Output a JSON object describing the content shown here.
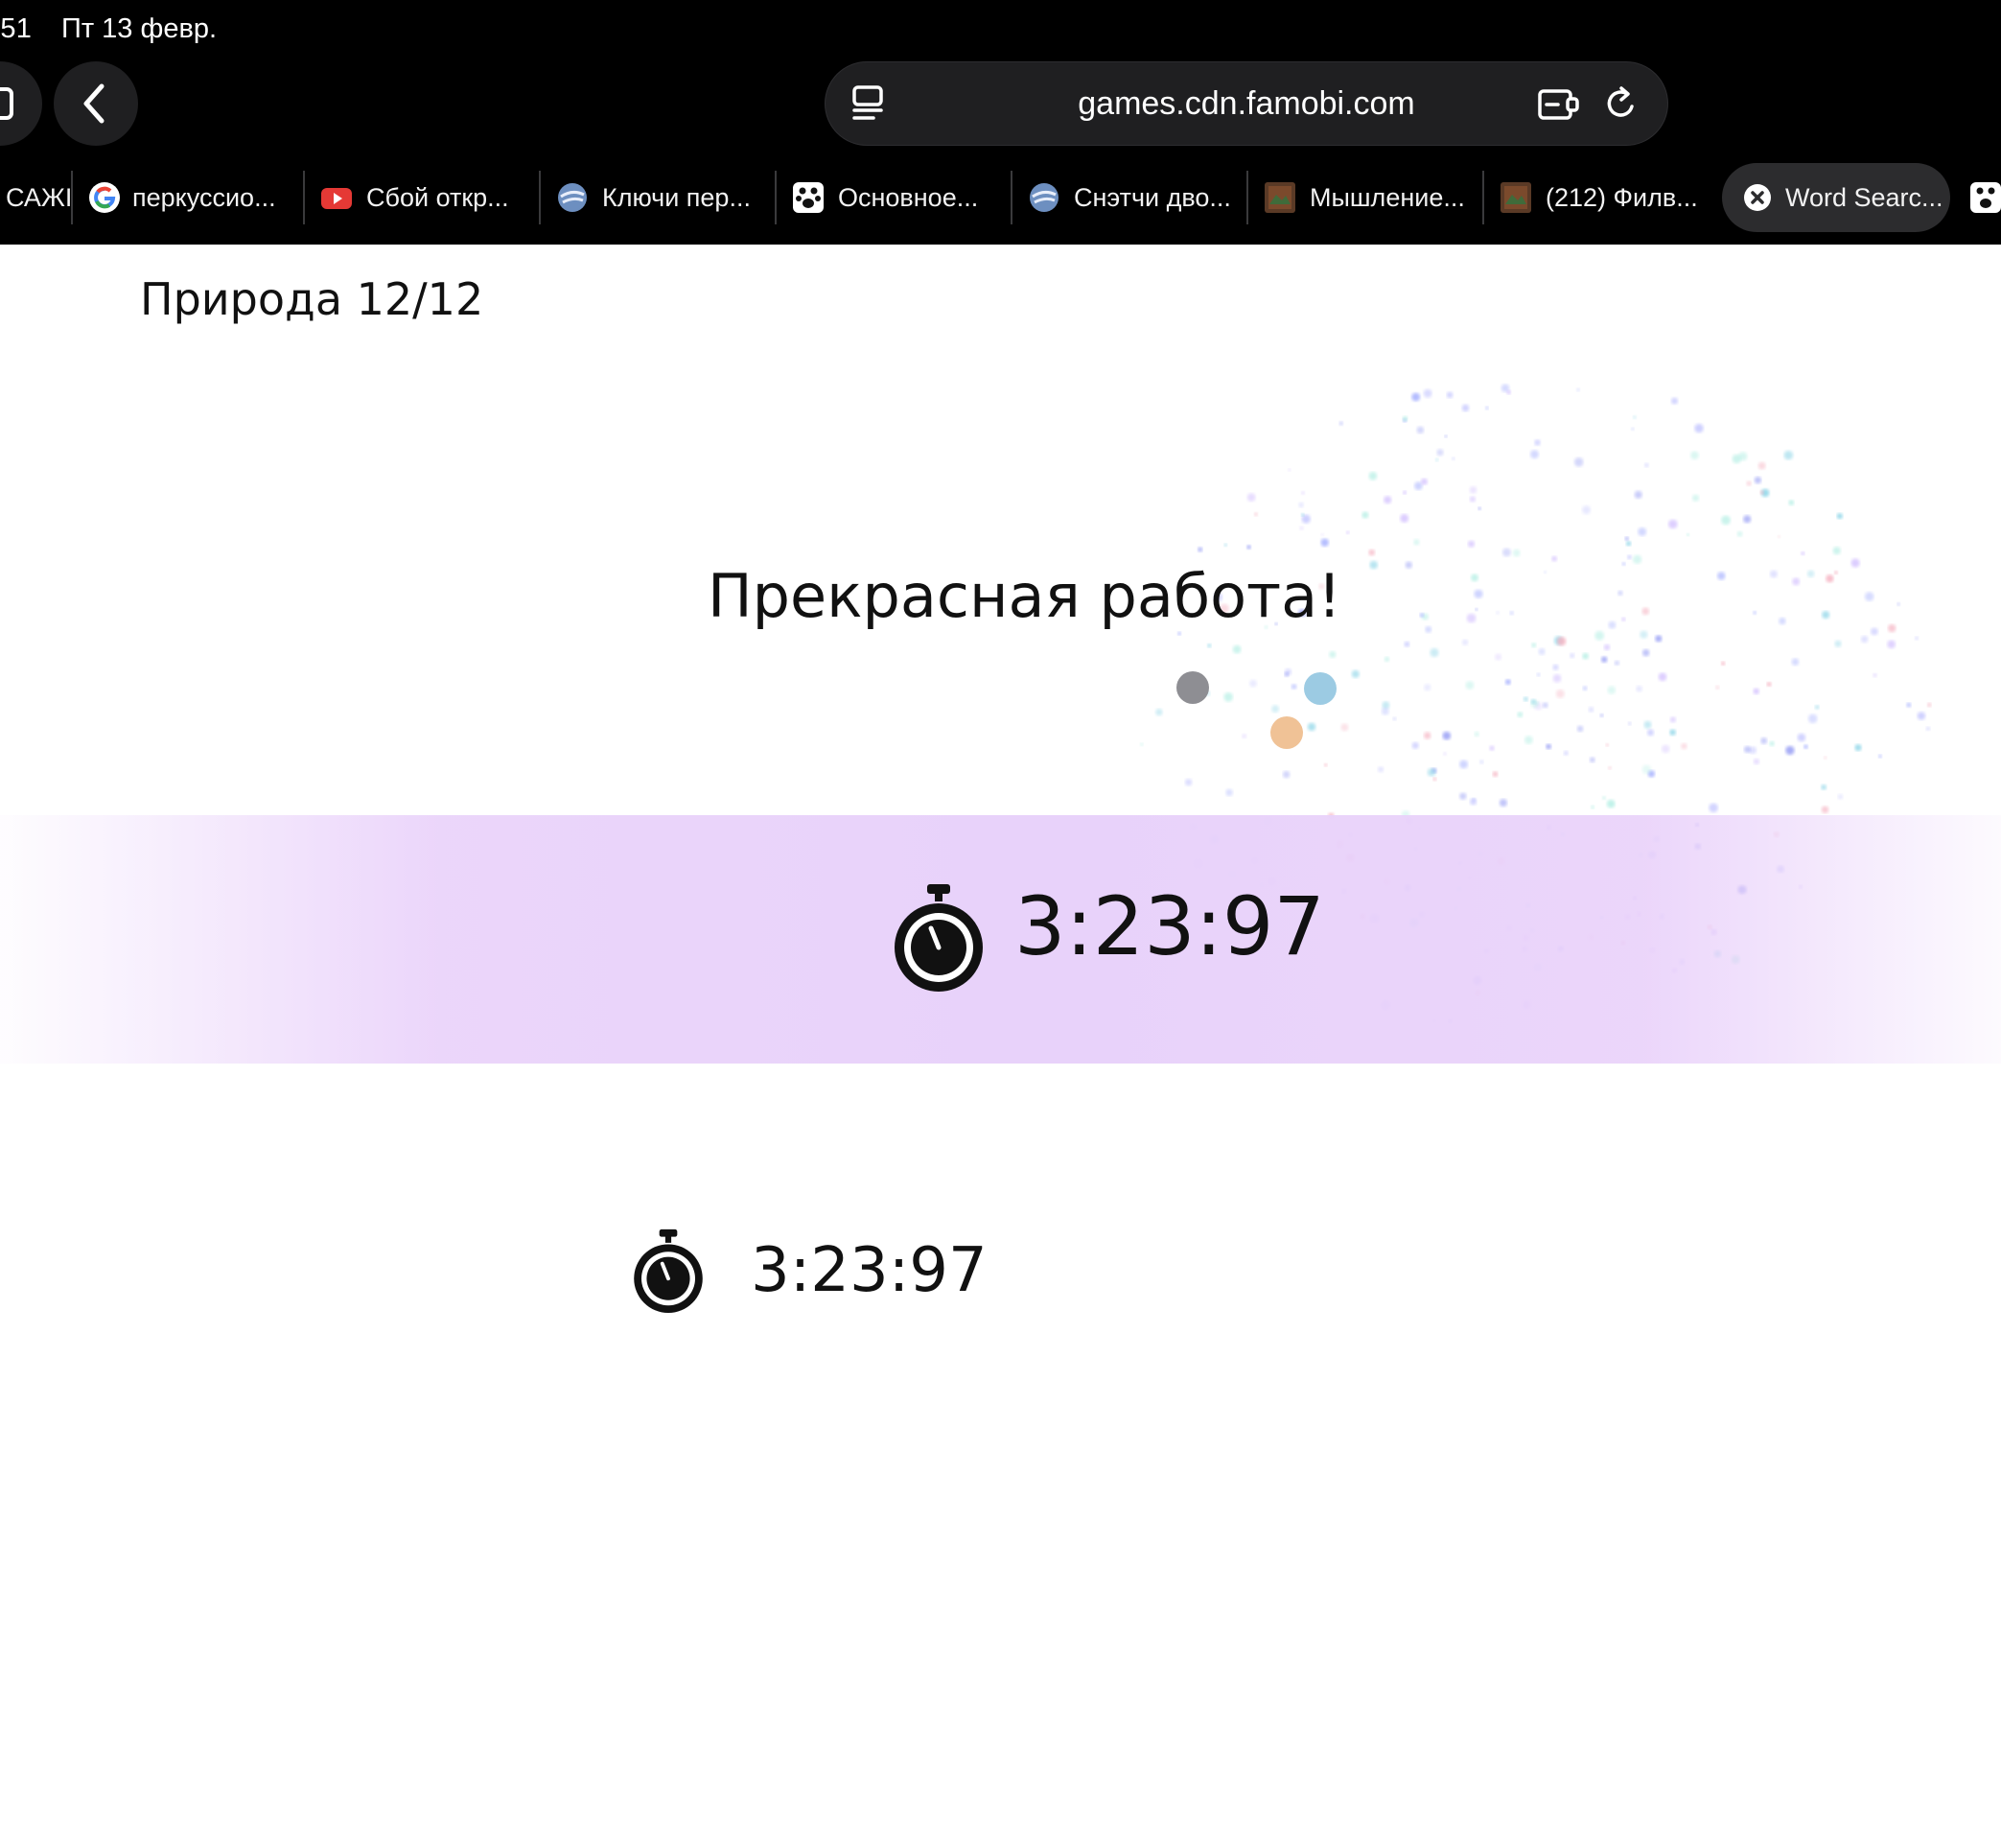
{
  "status_bar": {
    "time": ":51",
    "date": "Пт 13 февр."
  },
  "browser": {
    "url": "games.cdn.famobi.com",
    "tabs": [
      {
        "label": "САЖІ",
        "icon": "none"
      },
      {
        "label": "перкуссио...",
        "icon": "google-icon"
      },
      {
        "label": "Сбой откр...",
        "icon": "youtube-icon"
      },
      {
        "label": "Ключи пер...",
        "icon": "globe-icon"
      },
      {
        "label": "Основное...",
        "icon": "paw-icon"
      },
      {
        "label": "Снэтчи дво...",
        "icon": "globe-icon"
      },
      {
        "label": "Мышление...",
        "icon": "image-thumb-icon"
      },
      {
        "label": "(212) Филв...",
        "icon": "image-thumb-icon"
      },
      {
        "label": "Word Searc...",
        "icon": "close-icon",
        "active": true
      }
    ]
  },
  "game": {
    "category": "Природа 12/12",
    "congrats": "Прекрасная работа!",
    "time": "3:23:97",
    "best_time": "3:23:97",
    "dot_colors": [
      "#8e8e93",
      "#9ccbe3",
      "#f0c296"
    ],
    "band_color": "#e8d2fa"
  }
}
